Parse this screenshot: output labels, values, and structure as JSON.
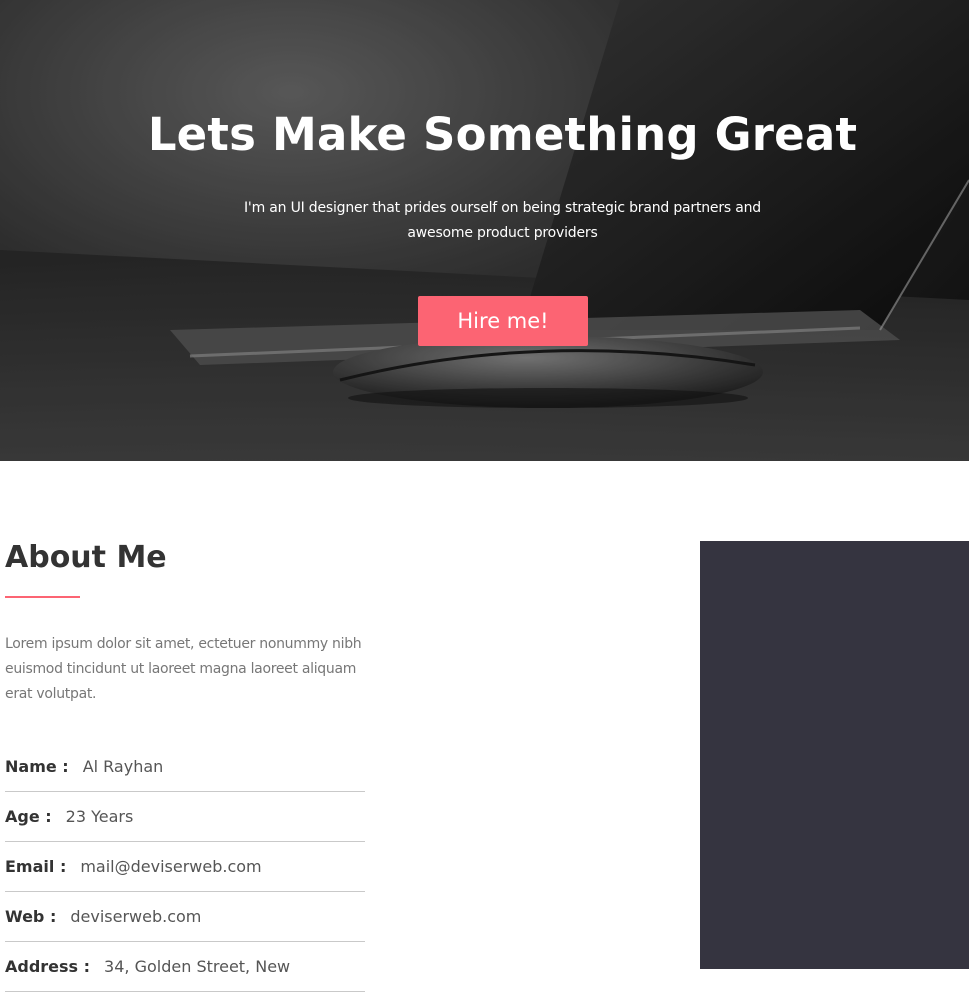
{
  "hero": {
    "title": "Lets Make Something Great",
    "subtitle": "I'm an UI designer that prides ourself on being strategic brand partners and awesome product providers",
    "button_label": "Hire me!",
    "button_color": "#fc6473"
  },
  "about": {
    "title": "About Me",
    "text": "Lorem ipsum dolor sit amet, ectetuer nonummy nibh euismod tincidunt ut laoreet magna laoreet aliquam erat volutpat.",
    "accent_color": "#fc6473",
    "info": [
      {
        "label": "Name :",
        "value": "Al Rayhan"
      },
      {
        "label": "Age :",
        "value": "23 Years"
      },
      {
        "label": "Email :",
        "value": "mail@deviserweb.com"
      },
      {
        "label": "Web :",
        "value": "deviserweb.com"
      },
      {
        "label": "Address :",
        "value": "34, Golden Street, New"
      }
    ]
  },
  "panel": {
    "color": "#353440"
  }
}
